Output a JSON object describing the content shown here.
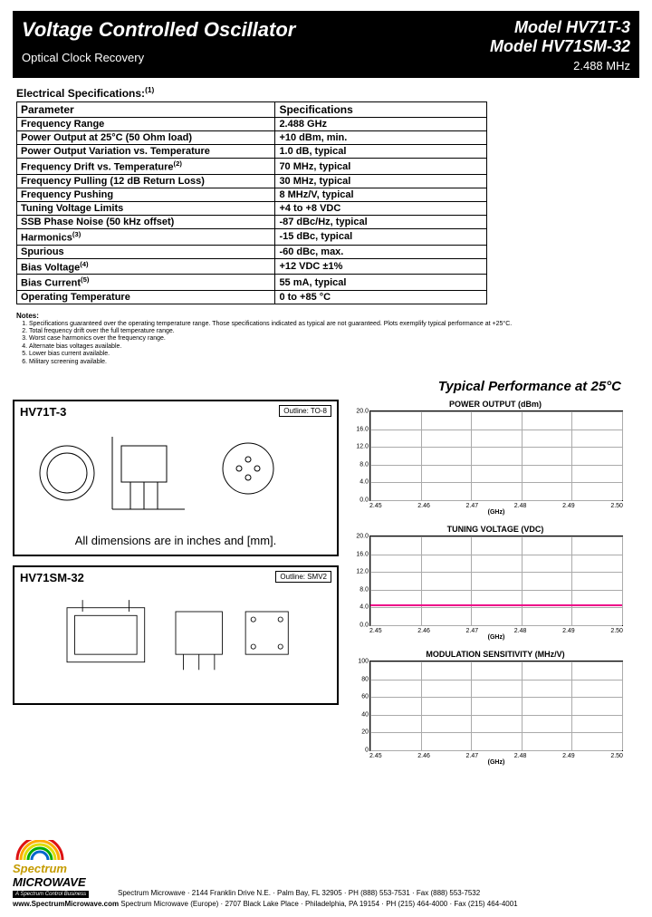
{
  "header": {
    "main_title": "Voltage Controlled Oscillator",
    "sub_title": "Optical Clock Recovery",
    "model1": "Model HV71T-3",
    "model2": "Model HV71SM-32",
    "freq": "2.488 MHz"
  },
  "spec_heading": "Electrical Specifications:",
  "spec_heading_sup": "(1)",
  "spec_table": {
    "head_param": "Parameter",
    "head_spec": "Specifications",
    "rows": [
      {
        "p": "Frequency Range",
        "s": "2.488 GHz"
      },
      {
        "p": "Power Output at 25°C (50 Ohm load)",
        "s": "+10 dBm, min."
      },
      {
        "p": "Power Output Variation vs. Temperature",
        "s": "1.0 dB, typical"
      },
      {
        "p": "Frequency Drift vs. Temperature",
        "sup": "(2)",
        "s": "70  MHz, typical"
      },
      {
        "p": "Frequency Pulling (12 dB Return Loss)",
        "s": "30 MHz, typical"
      },
      {
        "p": "Frequency Pushing",
        "s": "8 MHz/V, typical"
      },
      {
        "p": "Tuning Voltage Limits",
        "s": "+4 to +8 VDC"
      },
      {
        "p": "SSB Phase Noise (50 kHz offset)",
        "s": "-87 dBc/Hz, typical"
      },
      {
        "p": "Harmonics",
        "sup": "(3)",
        "s": "-15 dBc, typical"
      },
      {
        "p": "Spurious",
        "s": "-60 dBc, max."
      },
      {
        "p": "Bias Voltage",
        "sup": "(4)",
        "s": "+12 VDC ±1%"
      },
      {
        "p": "Bias Current",
        "sup": "(5)",
        "s": "55 mA, typical"
      },
      {
        "p": "Operating Temperature",
        "s": "0 to +85 °C"
      }
    ]
  },
  "notes": {
    "heading": "Notes:",
    "items": [
      "Specifications guaranteed over the operating temperature range. Those specifications indicated as typical are not guaranteed. Plots exemplify typical performance at +25°C.",
      "Total frequency drift over the full temperature range.",
      "Worst case harmonics over the frequency range.",
      "Alternate bias voltages available.",
      "Lower bias current available.",
      "Military screening available."
    ]
  },
  "perf_title": "Typical Performance at 25°C",
  "diagram1": {
    "label": "HV71T-3",
    "outline": "Outline: TO-8",
    "note": "All dimensions are in inches and [mm]."
  },
  "diagram2": {
    "label": "HV71SM-32",
    "outline": "Outline: SMV2"
  },
  "chart_data": [
    {
      "type": "line",
      "title": "POWER OUTPUT (dBm)",
      "xlabel": "(GHz)",
      "x": [
        2.45,
        2.46,
        2.47,
        2.48,
        2.49,
        2.5
      ],
      "yticks": [
        0.0,
        4.0,
        8.0,
        12.0,
        16.0,
        20.0
      ],
      "ylim": [
        0,
        20
      ],
      "series": []
    },
    {
      "type": "line",
      "title": "TUNING VOLTAGE (VDC)",
      "xlabel": "(GHz)",
      "x": [
        2.45,
        2.46,
        2.47,
        2.48,
        2.49,
        2.5
      ],
      "yticks": [
        0.0,
        4.0,
        8.0,
        12.0,
        16.0,
        20.0
      ],
      "ylim": [
        0,
        20
      ],
      "series": [
        {
          "name": "Tuning Voltage",
          "values": [
            4.0,
            4.2,
            4.5,
            4.8,
            5.0,
            5.2
          ]
        }
      ]
    },
    {
      "type": "line",
      "title": "MODULATION SENSITIVITY (MHz/V)",
      "xlabel": "(GHz)",
      "x": [
        2.45,
        2.46,
        2.47,
        2.48,
        2.49,
        2.5
      ],
      "yticks": [
        0,
        20,
        40,
        60,
        80,
        100
      ],
      "ylim": [
        0,
        100
      ],
      "series": []
    }
  ],
  "footer": {
    "logo1": "Spectrum",
    "logo2": "MICROWAVE",
    "logo_sub": "A Spectrum Control Business",
    "line1": "Spectrum Microwave · 2144 Franklin Drive N.E. · Palm Bay, FL 32905 · PH (888) 553-7531 · Fax (888) 553-7532",
    "line2_prefix": "www.SpectrumMicrowave.com",
    "line2": " Spectrum Microwave (Europe) · 2707 Black Lake Place · Philadelphia, PA 19154 · PH (215) 464-4000 · Fax (215) 464-4001"
  }
}
